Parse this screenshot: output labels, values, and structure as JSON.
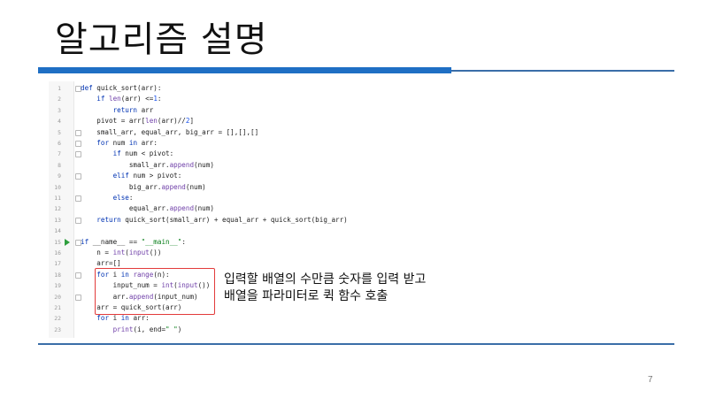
{
  "slide": {
    "title": "알고리즘 설명",
    "annotation_line1": "입력할 배열의 수만큼 숫자를 입력 받고",
    "annotation_line2": "배열을 파라미터로 퀵 함수 호출",
    "page_number": "7"
  },
  "colors": {
    "accent_bar": "#1f6fc4",
    "rule": "#3a6ea8",
    "highlight_border": "#e23b3b",
    "keyword": "#0033b3",
    "run_icon": "#2e9f3e"
  },
  "code": {
    "lines": [
      {
        "n": "1",
        "text": "def quick_sort(arr):"
      },
      {
        "n": "2",
        "text": "    if len(arr) <=1:"
      },
      {
        "n": "3",
        "text": "        return arr"
      },
      {
        "n": "4",
        "text": "    pivot = arr[len(arr)//2]"
      },
      {
        "n": "5",
        "text": "    small_arr, equal_arr, big_arr = [],[],[]"
      },
      {
        "n": "6",
        "text": "    for num in arr:"
      },
      {
        "n": "7",
        "text": "        if num < pivot:"
      },
      {
        "n": "8",
        "text": "            small_arr.append(num)"
      },
      {
        "n": "9",
        "text": "        elif num > pivot:"
      },
      {
        "n": "10",
        "text": "            big_arr.append(num)"
      },
      {
        "n": "11",
        "text": "        else:"
      },
      {
        "n": "12",
        "text": "            equal_arr.append(num)"
      },
      {
        "n": "13",
        "text": "    return quick_sort(small_arr) + equal_arr + quick_sort(big_arr)"
      },
      {
        "n": "14",
        "text": ""
      },
      {
        "n": "15",
        "text": "if __name__ == \"__main__\":"
      },
      {
        "n": "16",
        "text": "    n = int(input())"
      },
      {
        "n": "17",
        "text": "    arr=[]"
      },
      {
        "n": "18",
        "text": "    for i in range(n):"
      },
      {
        "n": "19",
        "text": "        input_num = int(input())"
      },
      {
        "n": "20",
        "text": "        arr.append(input_num)"
      },
      {
        "n": "21",
        "text": "    arr = quick_sort(arr)"
      },
      {
        "n": "22",
        "text": "    for i in arr:"
      },
      {
        "n": "23",
        "text": "        print(i, end=\" \")"
      }
    ]
  }
}
